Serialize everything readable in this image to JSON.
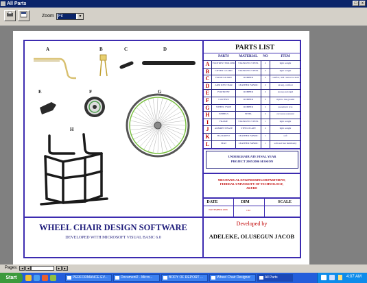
{
  "window": {
    "title": "All Parts"
  },
  "toolbar": {
    "zoom_label": "Zoom",
    "zoom_value": "Fit"
  },
  "figure_labels": {
    "a": "A",
    "b": "B",
    "c": "C",
    "d": "D",
    "e": "E",
    "f": "F",
    "g": "G",
    "h": "H"
  },
  "parts_list": {
    "title": "PARTS LIST",
    "headers": [
      "PARTS",
      "MATERIAL",
      "NO",
      "ITEM"
    ],
    "rows": [
      {
        "letter": "A",
        "part": "FOOTREST HOLDER",
        "material": "STAINLESS STEEL",
        "no": "2",
        "item": "light weight"
      },
      {
        "letter": "B",
        "part": "LIFTER GUARD",
        "material": "STAINLESS STEEL",
        "no": "2",
        "item": "light weight"
      },
      {
        "letter": "C",
        "part": "HAND GUARD",
        "material": "RUBBER",
        "no": "2",
        "item": "comfort, still cannot be held"
      },
      {
        "letter": "D",
        "part": "ARM REST BAR",
        "material": "LEATHER FABRIC",
        "no": "2",
        "item": "strong, comfort"
      },
      {
        "letter": "E",
        "part": "FOOTREST",
        "material": "RUBBER",
        "no": "2",
        "item": "strong and rigid"
      },
      {
        "letter": "F",
        "part": "CASTERS",
        "material": "RUBBER",
        "no": "2",
        "item": "rigid to the ground"
      },
      {
        "letter": "G",
        "part": "WHEEL TYRE",
        "material": "RUBBER",
        "no": "2",
        "item": "pneumatic tyre"
      },
      {
        "letter": "H",
        "part": "WHEELS",
        "material": "STEEL",
        "no": "2",
        "item": "corrosion resistant"
      },
      {
        "letter": "I",
        "part": "FRAME",
        "material": "STAINLESS STEEL",
        "no": "1",
        "item": "light weight"
      },
      {
        "letter": "J",
        "part": "ARMREST BASE",
        "material": "STEEL PLATE",
        "no": "2",
        "item": "light weight"
      },
      {
        "letter": "K",
        "part": "BACKREST",
        "material": "LEATHER FABRIC",
        "no": "1",
        "item": "soft"
      },
      {
        "letter": "L",
        "part": "SEAT",
        "material": "LEATHER FABRIC",
        "no": "1",
        "item": "soft and fast familiarity"
      }
    ]
  },
  "project_box": {
    "line1": "UNDERGRADUATE FINAL YEAR",
    "line2": "PROJECT 2005/2006 SESSION"
  },
  "dept_box": {
    "line1": "MECHANICAL ENGINEERING DEPARTMENT,",
    "line2": "FEDERAL UNIVERSITY OF TECHNOLOGY,",
    "line3": "AKURE"
  },
  "info_row": {
    "date_label": "DATE",
    "dim_label": "DIM",
    "scale_label": "SCALE",
    "date_value": "NOVEMBER 2006",
    "dim_value": "CM"
  },
  "main_title": {
    "title": "WHEEL CHAIR DESIGN SOFTWARE",
    "subtitle": "DEVELOPED WITH MICROSOFT VISUAL BASIC 6.0"
  },
  "developer": {
    "label": "Developed by",
    "name": "ADELEKE, OLUSEGUN JACOB"
  },
  "pages_bar": {
    "label": "Pages:"
  },
  "taskbar": {
    "start": "Start",
    "items": [
      "PERFORMANCE EV...",
      "Document2 - Micro...",
      "BODY OF REPORT ...",
      "Wheel Chair Designer",
      "All Parts"
    ],
    "clock": "4:07 AM"
  },
  "colors": {
    "border": "#3c2bb0",
    "red_letters": "#c00000",
    "title_blue": "#1d1b7a",
    "taskbar": "#245edb"
  }
}
